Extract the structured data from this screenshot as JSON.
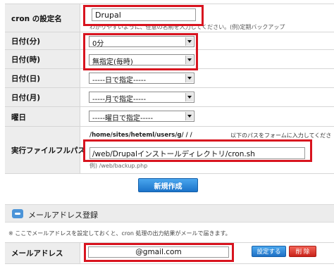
{
  "form": {
    "cron_name": {
      "label": "cron の設定名",
      "value": "Drupal",
      "hint": "わかりやすいように、任意の名前を入力してください。(例)定期バックアップ"
    },
    "day_min": {
      "label": "日付(分)",
      "selected": "0分"
    },
    "day_hour": {
      "label": "日付(時)",
      "selected": "無指定(毎時)"
    },
    "day_day": {
      "label": "日付(日)",
      "selected": "-----日で指定-----"
    },
    "day_month": {
      "label": "日付(月)",
      "selected": "-----月で指定-----"
    },
    "weekday": {
      "label": "曜日",
      "selected": "-----曜日で指定-----"
    },
    "exec_path": {
      "label": "実行ファイルフルパス",
      "base_path": "/home/sites/heteml/users/g/  /  /",
      "instruction": "以下のパスをフォームに入力してくださ",
      "value": "/web/Drupalインストールディレクトリ/cron.sh",
      "example": "例) /web/backup.php"
    }
  },
  "create_button": "新規作成",
  "mail_section": {
    "title": "メールアドレス登録",
    "note": "※ ここでメールアドレスを設定しておくと、cron 処理の出力結果がメールで届きます。",
    "label": "メールアドレス",
    "value": "@gmail.com",
    "set_button": "設定する",
    "delete_button": "削 除"
  },
  "colors": {
    "highlight": "#d8141f",
    "primary_button": "#1b73c9",
    "delete_button": "#c8231a",
    "label_bg": "#ededed"
  }
}
